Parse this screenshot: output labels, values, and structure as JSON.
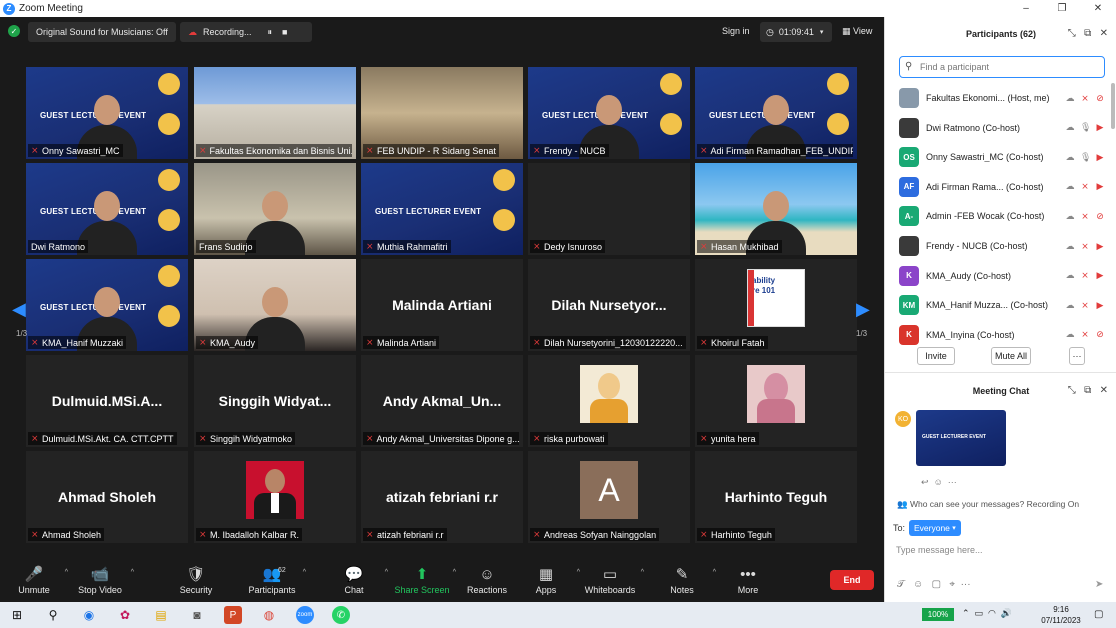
{
  "window": {
    "title": "Zoom Meeting",
    "min": "–",
    "max": "❐",
    "close": "✕"
  },
  "topbar": {
    "sound": "Original Sound for Musicians: Off",
    "recording": "Recording...",
    "pause": "⏸",
    "stop": "■",
    "signin": "Sign in",
    "timer": "01:09:41",
    "view": "View"
  },
  "slide_text": "GUEST LECTURER EVENT",
  "tiles": [
    {
      "name": "Onny Sawastri_MC",
      "bg": "slide",
      "person": true,
      "active": true,
      "mic": "muted"
    },
    {
      "name": "Fakultas Ekonomika dan Bisnis Uni...",
      "bg": "bldg",
      "person": false,
      "mic": "muted"
    },
    {
      "name": "FEB UNDIP - R Sidang Senat",
      "bg": "room",
      "person": false,
      "mic": "muted"
    },
    {
      "name": "Frendy - NUCB",
      "bg": "slide",
      "person": true,
      "mic": "muted"
    },
    {
      "name": "Adi Firman Ramadhan_FEB_UNDIP",
      "bg": "slide",
      "person": true,
      "mic": "muted"
    },
    {
      "name": "Dwi Ratmono",
      "bg": "slide",
      "person": true,
      "mic": "none"
    },
    {
      "name": "Frans Sudirjo",
      "bg": "room2",
      "person": true,
      "mic": "none"
    },
    {
      "name": "Muthia Rahmafitri",
      "bg": "slide",
      "person": false,
      "mic": "muted"
    },
    {
      "name": "Dedy Isnuroso",
      "bg": "blank",
      "person": false,
      "mic": "muted"
    },
    {
      "name": "Hasan Mukhibad",
      "bg": "beach",
      "person": true,
      "mic": "muted"
    },
    {
      "name": "KMA_Hanif Muzzaki",
      "bg": "slide",
      "person": true,
      "mic": "muted"
    },
    {
      "name": "KMA_Audy",
      "bg": "selfie",
      "person": true,
      "mic": "muted"
    },
    {
      "name": "Malinda Artiani",
      "big": "Malinda Artiani",
      "mic": "muted"
    },
    {
      "name": "Dilah Nursetyorini_12030122220...",
      "big": "Dilah  Nursetyor...",
      "mic": "muted"
    },
    {
      "name": "Khoirul Fatah",
      "photo": "sustain",
      "photo_text": "ability\nre 101",
      "mic": "muted"
    },
    {
      "name": "Dulmuid.MSi.Akt. CA. CTT.CPTT",
      "big": "Dulmuid.MSi.A...",
      "mic": "muted"
    },
    {
      "name": "Singgih Widyatmoko",
      "big": "Singgih  Widyat...",
      "mic": "muted"
    },
    {
      "name": "Andy Akmal_Universitas Dipone g...",
      "big": "Andy  Akmal_Un...",
      "mic": "muted"
    },
    {
      "name": "riska purbowati",
      "photo": "sketch",
      "mic": "muted"
    },
    {
      "name": "yunita hera",
      "photo": "hijab",
      "mic": "muted"
    },
    {
      "name": "Ahmad Sholeh",
      "big": "Ahmad Sholeh",
      "mic": "muted"
    },
    {
      "name": "M. Ibadalloh Kalbar R.",
      "photo": "formal",
      "mic": "muted"
    },
    {
      "name": "atizah febriani r.r",
      "big": "atizah febriani r.r",
      "mic": "muted"
    },
    {
      "name": "Andreas Sofyan Nainggolan",
      "avatar": "A",
      "mic": "muted"
    },
    {
      "name": "Harhinto Teguh",
      "big": "Harhinto Teguh",
      "mic": "muted"
    }
  ],
  "pager": {
    "left": "1/3",
    "right": "1/3",
    "prev": "◀",
    "next": "▶"
  },
  "toolbar": [
    {
      "label": "Unmute",
      "icon": "🎤",
      "icon_name": "mic-muted-icon",
      "caret": true
    },
    {
      "label": "Stop Video",
      "icon": "📹",
      "icon_name": "video-icon",
      "caret": true
    },
    {
      "label": "Security",
      "icon": "🛡",
      "icon_name": "shield-icon",
      "caret": false
    },
    {
      "label": "Participants",
      "icon": "👥",
      "icon_name": "participants-icon",
      "caret": true,
      "badge": "62"
    },
    {
      "label": "Chat",
      "icon": "💬",
      "icon_name": "chat-icon",
      "caret": true
    },
    {
      "label": "Share Screen",
      "icon": "⬆",
      "icon_name": "share-screen-icon",
      "caret": true,
      "green": true
    },
    {
      "label": "Reactions",
      "icon": "☺",
      "icon_name": "reactions-icon",
      "caret": false
    },
    {
      "label": "Apps",
      "icon": "▦",
      "icon_name": "apps-icon",
      "caret": true
    },
    {
      "label": "Whiteboards",
      "icon": "▭",
      "icon_name": "whiteboard-icon",
      "caret": true
    },
    {
      "label": "Notes",
      "icon": "✎",
      "icon_name": "notes-icon",
      "caret": true
    },
    {
      "label": "More",
      "icon": "•••",
      "icon_name": "more-icon",
      "caret": false
    }
  ],
  "end_label": "End",
  "participants": {
    "title": "Participants (62)",
    "search_placeholder": "Find a participant",
    "list": [
      {
        "name": "Fakultas Ekonomi... (Host, me)",
        "initials": "",
        "color": "#8899aa",
        "video_muted": true
      },
      {
        "name": "Dwi Ratmono (Co-host)",
        "initials": "",
        "color": "#3a3a3a",
        "mic": "on",
        "video_muted": false
      },
      {
        "name": "Onny Sawastri_MC (Co-host)",
        "initials": "OS",
        "color": "#19a974",
        "mic": "on",
        "video_muted": false
      },
      {
        "name": "Adi Firman Rama... (Co-host)",
        "initials": "AF",
        "color": "#2d6cdf",
        "video_muted": false
      },
      {
        "name": "Admin -FEB Wocak (Co-host)",
        "initials": "A-",
        "color": "#19a974",
        "video_muted": true
      },
      {
        "name": "Frendy - NUCB (Co-host)",
        "initials": "",
        "color": "#3a3a3a",
        "video_muted": false
      },
      {
        "name": "KMA_Audy (Co-host)",
        "initials": "K",
        "color": "#8b44c9",
        "video_muted": false
      },
      {
        "name": "KMA_Hanif Muzza... (Co-host)",
        "initials": "KM",
        "color": "#19a974",
        "video_muted": false
      },
      {
        "name": "KMA_Inyina (Co-host)",
        "initials": "K",
        "color": "#d9342b",
        "video_muted": true
      }
    ],
    "invite": "Invite",
    "mute_all": "Mute All",
    "more": "···"
  },
  "chat": {
    "title": "Meeting Chat",
    "sender_initials": "KO",
    "image_text": "GUEST LECTURER EVENT",
    "who_can_see": "Who can see your messages? Recording On",
    "to_label": "To:",
    "to_value": "Everyone",
    "placeholder": "Type message here..."
  },
  "taskbar": {
    "battery": "100%",
    "time": "9:16",
    "date": "07/11/2023"
  }
}
